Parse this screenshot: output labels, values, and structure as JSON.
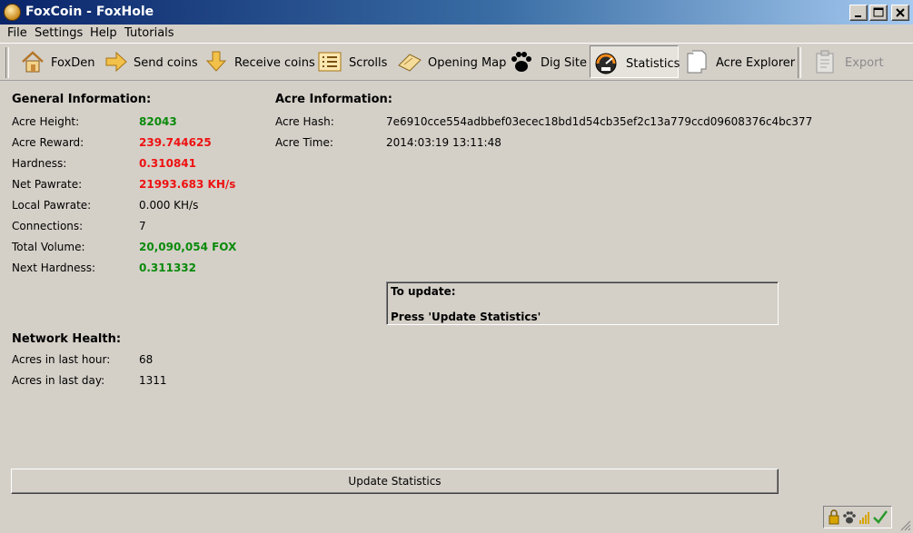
{
  "window": {
    "title": "FoxCoin - FoxHole"
  },
  "menu": [
    "File",
    "Settings",
    "Help",
    "Tutorials"
  ],
  "toolbar": {
    "foxden": "FoxDen",
    "send": "Send coins",
    "receive": "Receive coins",
    "scrolls": "Scrolls",
    "opening_map": "Opening Map",
    "dig_site": "Dig Site",
    "statistics": "Statistics",
    "acre_explorer": "Acre Explorer",
    "export": "Export",
    "active": "Statistics"
  },
  "general": {
    "heading": "General Information:",
    "rows": [
      {
        "label": "Acre Height:",
        "value": "82043",
        "color": "#0b8a0b"
      },
      {
        "label": "Acre Reward:",
        "value": "239.744625",
        "color": "#ee1111"
      },
      {
        "label": "Hardness:",
        "value": "0.310841",
        "color": "#ee1111"
      },
      {
        "label": "Net Pawrate:",
        "value": "21993.683 KH/s",
        "color": "#ee1111"
      },
      {
        "label": "Local Pawrate:",
        "value": "0.000 KH/s",
        "color": "#000000"
      },
      {
        "label": "Connections:",
        "value": "7",
        "color": "#000000"
      },
      {
        "label": "Total Volume:",
        "value": "20,090,054 FOX",
        "color": "#0b8a0b"
      },
      {
        "label": "Next Hardness:",
        "value": "0.311332",
        "color": "#0b8a0b"
      }
    ]
  },
  "acre": {
    "heading": "Acre Information:",
    "hash_label": "Acre Hash:",
    "hash_value": "7e6910cce554adbbef03ecec18bd1d54cb35ef2c13a779ccd09608376c4bc377",
    "time_label": "Acre Time:",
    "time_value": "2014:03:19 13:11:48"
  },
  "update_box": {
    "line1": "To update:",
    "line2": "Press 'Update Statistics'"
  },
  "network": {
    "heading": "Network Health:",
    "last_hour_label": "Acres in last hour:",
    "last_hour_value": "68",
    "last_day_label": "Acres in last day:",
    "last_day_value": "1311"
  },
  "update_button": "Update Statistics",
  "status_icons": [
    "lock-icon",
    "paw-icon",
    "signal-icon",
    "check-icon"
  ]
}
